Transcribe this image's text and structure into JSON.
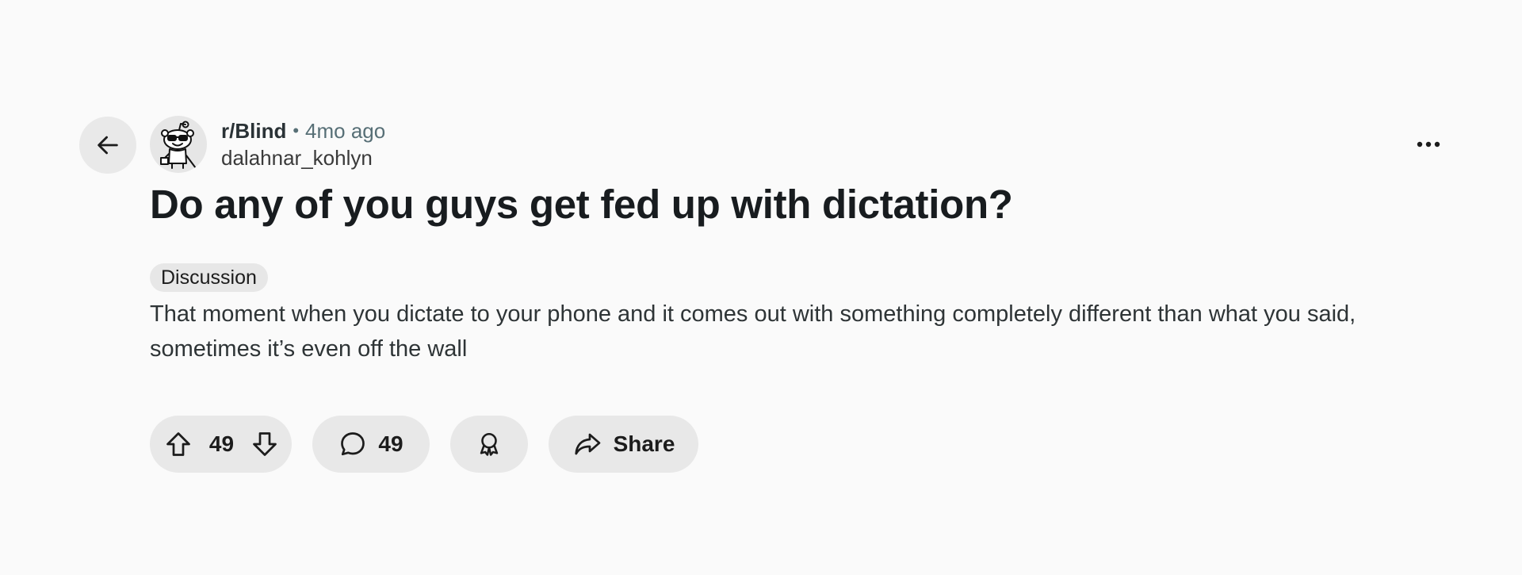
{
  "post": {
    "subreddit": "r/Blind",
    "separator": "•",
    "age": "4mo ago",
    "author": "dalahnar_kohlyn",
    "title": "Do any of you guys get fed up with dictation?",
    "flair": "Discussion",
    "body": "That moment when you dictate to your phone and it comes out with something completely different than what you said, sometimes it’s even off the wall"
  },
  "actions": {
    "score": "49",
    "comments_count": "49",
    "share_label": "Share"
  },
  "icons": {
    "back": "arrow-left-icon",
    "avatar": "snoo-avatar",
    "more": "more-horizontal-icon",
    "upvote": "arrow-up-icon",
    "downvote": "arrow-down-icon",
    "comment": "comment-bubble-icon",
    "award": "award-icon",
    "share": "share-arrow-icon"
  },
  "colors": {
    "background": "#fafafa",
    "pill": "#e8e8e8",
    "text": "#1c1c1c",
    "muted": "#576f76"
  }
}
